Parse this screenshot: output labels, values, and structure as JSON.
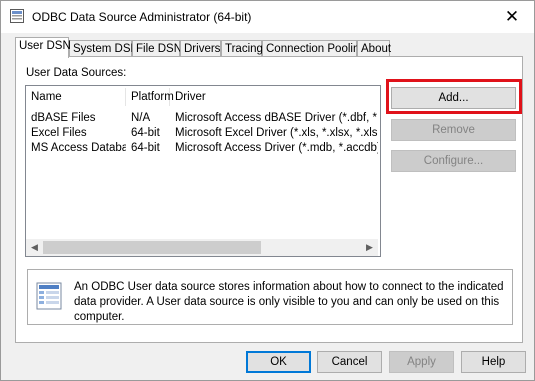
{
  "window": {
    "title": "ODBC Data Source Administrator (64-bit)"
  },
  "tabs": [
    {
      "label": "User DSN",
      "active": true
    },
    {
      "label": "System DSN"
    },
    {
      "label": "File DSN"
    },
    {
      "label": "Drivers"
    },
    {
      "label": "Tracing"
    },
    {
      "label": "Connection Pooling"
    },
    {
      "label": "About"
    }
  ],
  "panel": {
    "label": "User Data Sources:",
    "columns": [
      "Name",
      "Platform",
      "Driver"
    ],
    "rows": [
      {
        "name": "dBASE Files",
        "platform": "N/A",
        "driver": "Microsoft Access dBASE Driver (*.dbf, *.ndx, *.m"
      },
      {
        "name": "Excel Files",
        "platform": "64-bit",
        "driver": "Microsoft Excel Driver (*.xls, *.xlsx, *.xlsm, *.xlsb)"
      },
      {
        "name": "MS Access Database",
        "platform": "64-bit",
        "driver": "Microsoft Access Driver (*.mdb, *.accdb)"
      }
    ],
    "buttons": {
      "add": "Add...",
      "remove": "Remove",
      "configure": "Configure..."
    },
    "info": "An ODBC User data source stores information about how to connect to the indicated data provider.  A User data source is only visible to you and can only be used on this computer."
  },
  "footer": {
    "ok": "OK",
    "cancel": "Cancel",
    "apply": "Apply",
    "help": "Help"
  },
  "colors": {
    "highlight": "#e0121a",
    "accent": "#0078d7"
  }
}
